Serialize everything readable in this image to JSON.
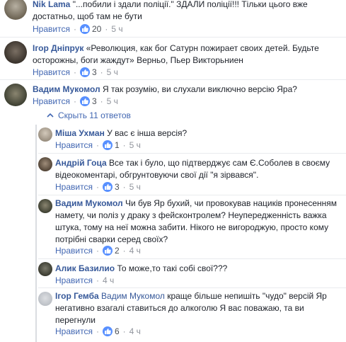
{
  "comments": [
    {
      "author": "Nik Lama",
      "text": " \"...побили і здали поліції.\" ЗДАЛИ поліції!!! Тільки цього вже достатньо, щоб там не бути",
      "like_label": "Нравится",
      "likes": "20",
      "time": "5 ч"
    },
    {
      "author": "Ігор Дніпрук",
      "text": " «Революция, как бог Сатурн пожирает своих детей. Будьте осторожны, боги жаждут» Верньо, Пьер Викторьниен",
      "like_label": "Нравится",
      "likes": "3",
      "time": "5 ч"
    },
    {
      "author": "Вадим Мукомол",
      "text": " Я так розумію, ви слухали виключно версію Яра?",
      "like_label": "Нравится",
      "likes": "3",
      "time": "5 ч"
    }
  ],
  "replies_toggle": "Скрыть 11 ответов",
  "replies": [
    {
      "author": "Міша Ухман",
      "text": " У вас є інша версія?",
      "like_label": "Нравится",
      "likes": "1",
      "time": "5 ч"
    },
    {
      "author": "Андрій Гоца",
      "text": " Все так і було, що підтверджує сам Є.Соболев в своєму відеокоментарі, обгрунтовуючи свої дії \"я зірвався\".",
      "like_label": "Нравится",
      "likes": "3",
      "time": "5 ч"
    },
    {
      "author": "Вадим Мукомол",
      "text": " Чи був Яр бухий, чи провокував нациків пронесенням намету, чи поліз у драку з фейсконтролем? Неупередженність важка штука, тому на неї можна забити. Нікого не вигороджую, просто кому потрібні сварки серед своїх?",
      "like_label": "Нравится",
      "likes": "2",
      "time": "4 ч"
    },
    {
      "author": "Алик Базилио",
      "text": " То може,то такі собі свої???",
      "like_label": "Нравится",
      "time": "4 ч"
    },
    {
      "author": "Ігор Гемба",
      "mention": "Вадим Мукомол",
      "text": " краще більше непишіть \"чудо\" версій Яр негативно взагалі ставиться до алкоголю Я вас поважаю, та ви перегнули",
      "like_label": "Нравится",
      "likes": "6",
      "time": "4 ч"
    }
  ],
  "colors": {
    "link": "#365899",
    "action": "#4267b2",
    "meta": "#90949c",
    "like_badge": "#5890ff"
  }
}
